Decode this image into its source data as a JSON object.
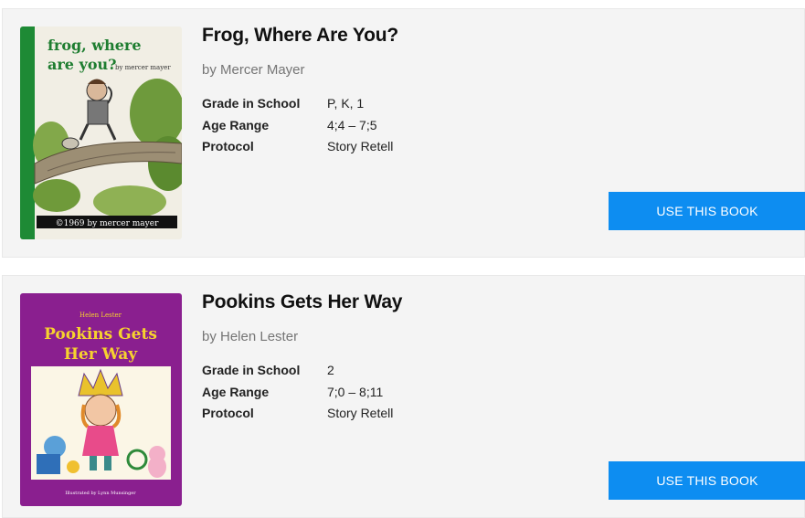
{
  "books": [
    {
      "title": "Frog, Where Are You?",
      "author": "by Mercer Mayer",
      "grade_label": "Grade in School",
      "grade": "P, K, 1",
      "age_label": "Age Range",
      "age": "4;4 – 7;5",
      "protocol_label": "Protocol",
      "protocol": "Story Retell",
      "button_label": "USE THIS BOOK",
      "cover": {
        "title_line1": "frog, where",
        "title_line2": "are you?",
        "by_line": "by mercer mayer",
        "copyright": "©1969 by mercer mayer",
        "spine_color": "#1e8a35"
      }
    },
    {
      "title": "Pookins Gets Her Way",
      "author": "by Helen Lester",
      "grade_label": "Grade in School",
      "grade": "2",
      "age_label": "Age Range",
      "age": "7;0 – 8;11",
      "protocol_label": "Protocol",
      "protocol": "Story Retell",
      "button_label": "USE THIS BOOK",
      "cover": {
        "author": "Helen Lester",
        "title_line1": "Pookins Gets",
        "title_line2": "Her Way",
        "illustrator": "Illustrated by Lynn Munsinger",
        "background_color": "#8a1f8f",
        "title_color": "#f7d22e"
      }
    }
  ],
  "colors": {
    "button": "#0d8df1",
    "card_background": "#f4f4f4"
  }
}
